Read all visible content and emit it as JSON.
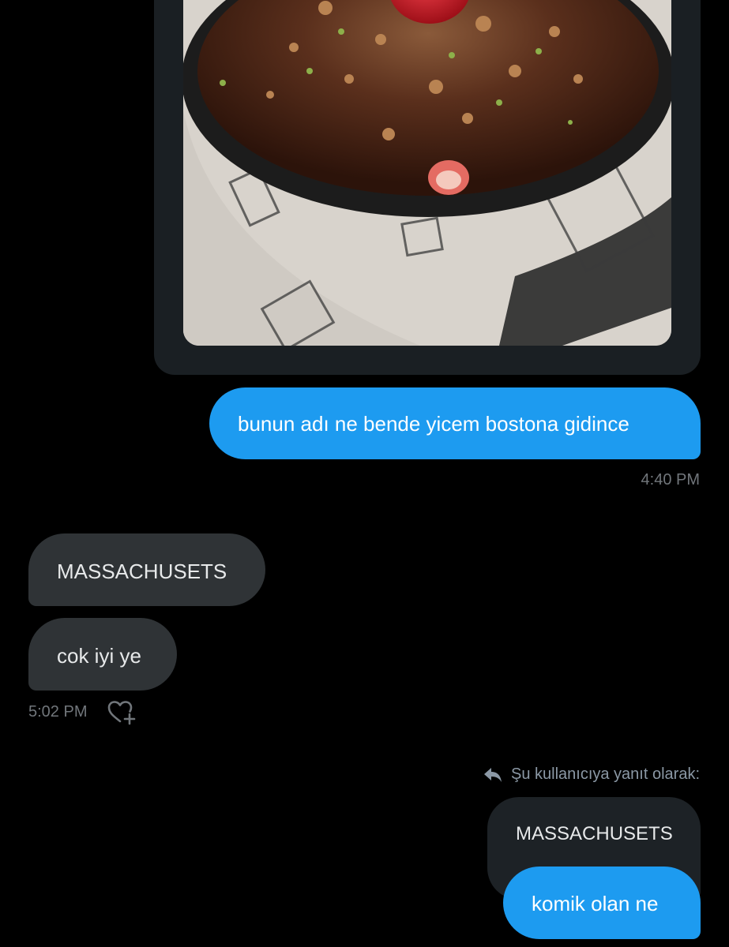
{
  "conversation": {
    "shared_photo": {
      "description_icon": "photo-of-chocolate-dessert-with-strawberry"
    },
    "sent_message_1": {
      "text": "bunun adı ne bende yicem bostona gidince",
      "time": "4:40 PM"
    },
    "received_messages": [
      {
        "text": "MASSACHUSETS"
      },
      {
        "text": "cok iyi ye"
      }
    ],
    "received_time": "5:02 PM",
    "react_icon": "heart-plus-icon",
    "reply": {
      "note": "Şu kullanıcıya yanıt olarak:",
      "note_icon": "reply-arrow-icon",
      "quoted_text": "MASSACHUSETS",
      "text": "komik olan ne"
    }
  },
  "colors": {
    "background": "#000000",
    "sent_bubble": "#1d9bf0",
    "received_bubble": "#2f3336",
    "timestamp": "#71767b"
  }
}
